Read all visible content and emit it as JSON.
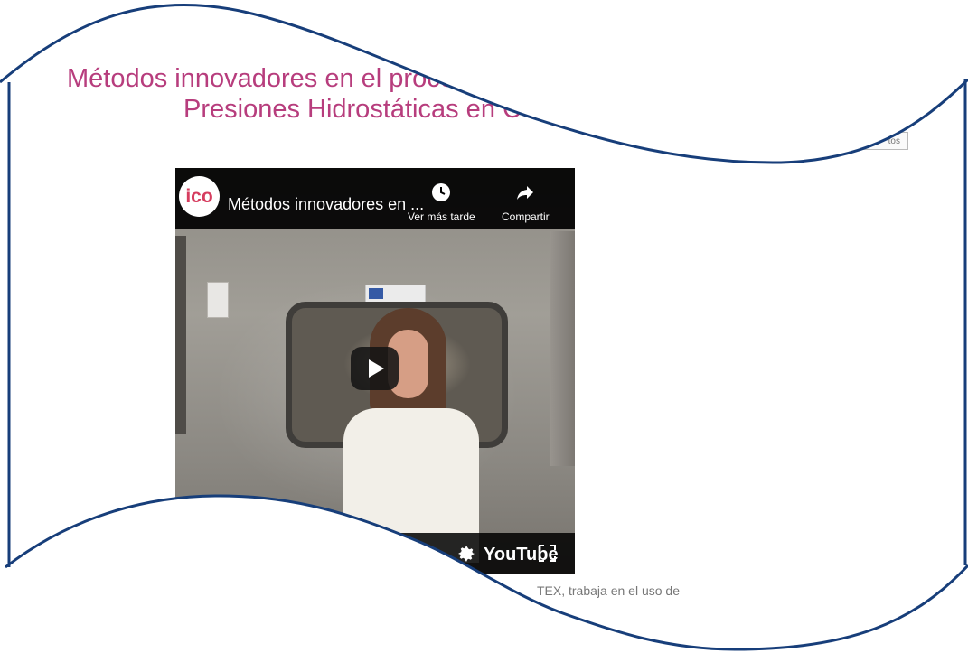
{
  "title": {
    "line1": "Métodos innovadores en el procesado",
    "line2": "Presiones Hidrostáticas en CICYTEX"
  },
  "badges": [
    {
      "name": "info-red",
      "icon": "info-icon",
      "color": "#d63f3a"
    },
    {
      "name": "info-yellow",
      "icon": "info-icon",
      "color": "#e9b221"
    },
    {
      "name": "info-green",
      "icon": "info-icon",
      "color": "#72a72d"
    },
    {
      "name": "info-orange",
      "icon": "info-icon",
      "color": "#e37a2d"
    },
    {
      "name": "info-blue",
      "icon": "info-icon",
      "color": "#2f82b7"
    }
  ],
  "side_button": {
    "label": "tos"
  },
  "video": {
    "channel_logo": "ico",
    "title": "Métodos innovadores en ...",
    "watch_later_label": "Ver más tarde",
    "share_label": "Compartir",
    "youtube_label": "YouTube"
  },
  "body_snippet": "TEX, trabaja en el uso de"
}
